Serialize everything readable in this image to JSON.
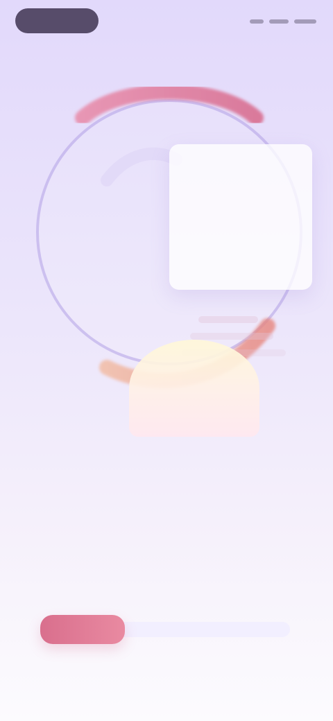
{
  "screen": {
    "status_area": {
      "pill_label": "",
      "right_indicators": [
        "",
        "",
        ""
      ]
    },
    "illustration": {
      "card_kicker": "",
      "card_big_value": ""
    },
    "onboarding": {
      "title_line_1": "",
      "title_line_2": ""
    },
    "progress": {
      "value_fraction": 0.34
    },
    "colors": {
      "accent": "#d96f8d",
      "ring": "#e07aa5",
      "outer_circle": "#b4a3e6",
      "background_top": "#e2d9fb",
      "background_bottom": "#fcfbfe"
    }
  }
}
